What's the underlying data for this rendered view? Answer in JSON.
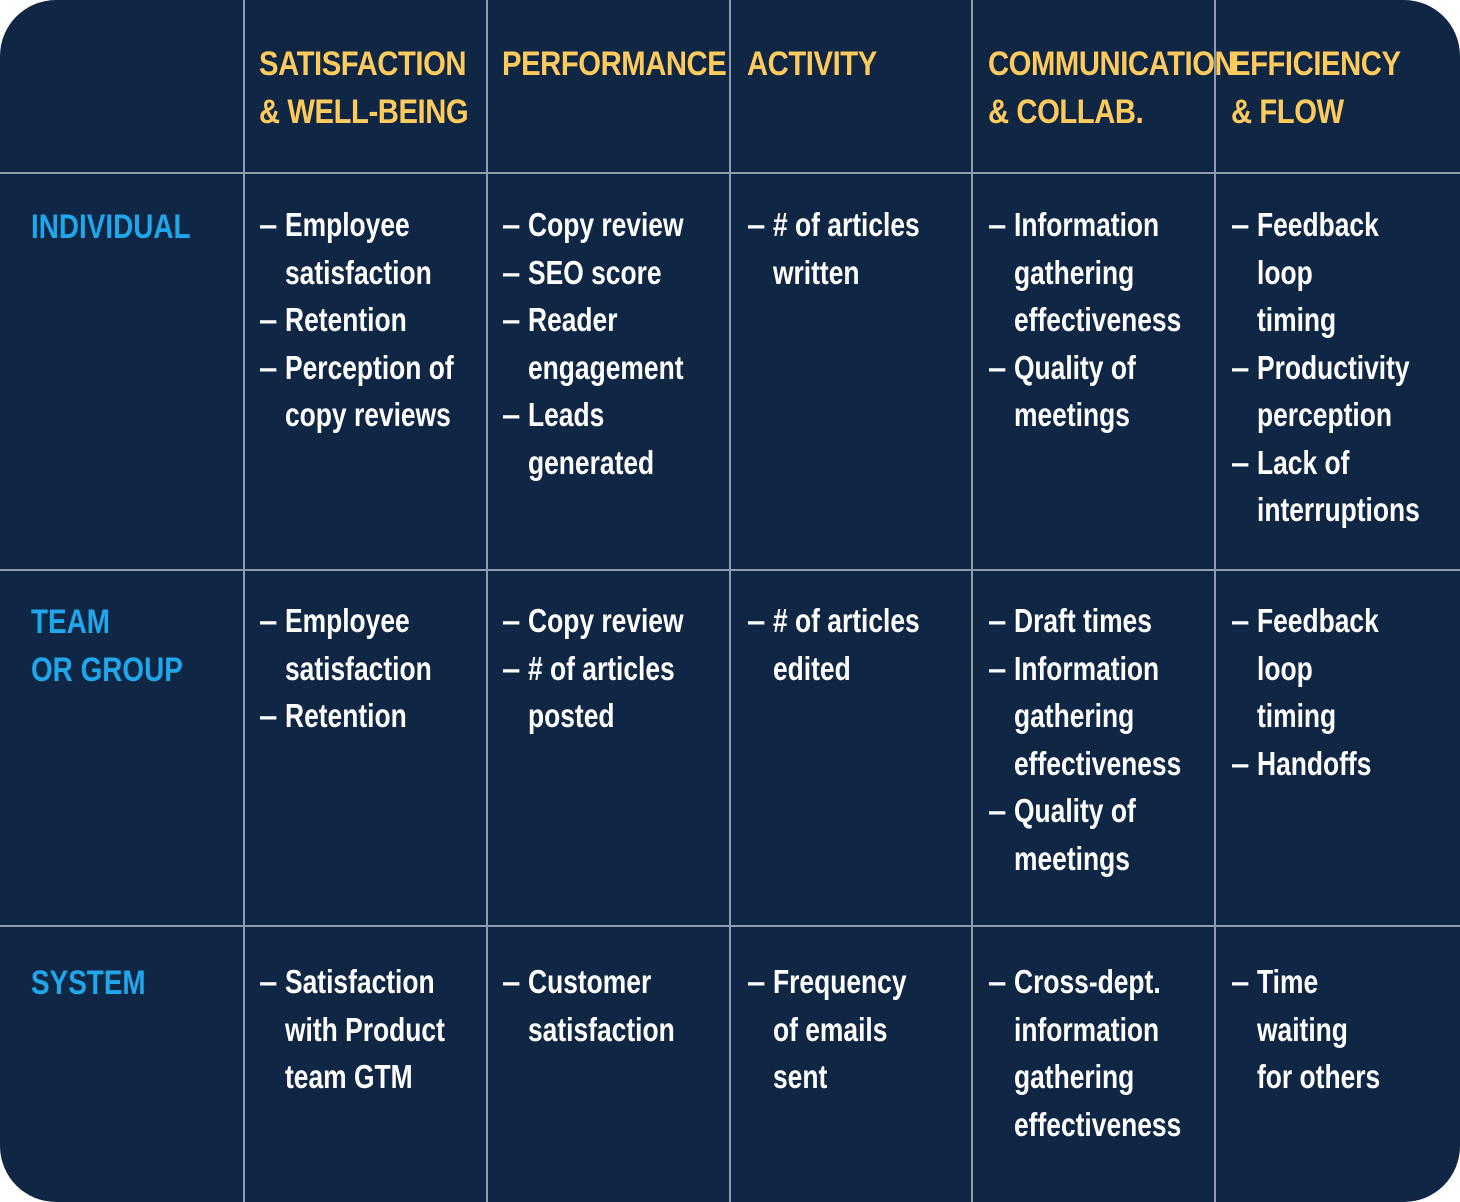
{
  "colors": {
    "background": "#0f2645",
    "grid_line": "#8e9db0",
    "column_header": "#fecb5c",
    "row_header": "#20a6ea",
    "cell_text": "#ffffff"
  },
  "columns": [
    {
      "label": "SATISFACTION\n& WELL-BEING"
    },
    {
      "label": "PERFORMANCE"
    },
    {
      "label": "ACTIVITY"
    },
    {
      "label": "COMMUNICATION\n& COLLAB."
    },
    {
      "label": "EFFICIENCY\n& FLOW"
    }
  ],
  "rows": [
    {
      "label": "INDIVIDUAL",
      "cells": [
        [
          "Employee\nsatisfaction",
          "Retention",
          "Perception of\ncopy reviews"
        ],
        [
          "Copy review",
          "SEO score",
          "Reader\nengagement",
          "Leads\ngenerated"
        ],
        [
          "# of articles\nwritten"
        ],
        [
          "Information\ngathering\neffectiveness",
          "Quality of\nmeetings"
        ],
        [
          "Feedback\nloop\ntiming",
          "Productivity\nperception",
          "Lack of\ninterruptions"
        ]
      ]
    },
    {
      "label": "TEAM\nOR GROUP",
      "cells": [
        [
          "Employee\nsatisfaction",
          "Retention"
        ],
        [
          "Copy review",
          "# of articles\nposted"
        ],
        [
          "# of articles\nedited"
        ],
        [
          "Draft times",
          "Information\ngathering\neffectiveness",
          "Quality of\nmeetings"
        ],
        [
          "Feedback\nloop\ntiming",
          "Handoffs"
        ]
      ]
    },
    {
      "label": "SYSTEM",
      "cells": [
        [
          "Satisfaction\nwith Product\nteam GTM"
        ],
        [
          "Customer\nsatisfaction"
        ],
        [
          "Frequency\nof emails\nsent"
        ],
        [
          "Cross-dept.\ninformation\ngathering\neffectiveness"
        ],
        [
          "Time\nwaiting\nfor others"
        ]
      ]
    }
  ],
  "bullet_glyph": "–"
}
